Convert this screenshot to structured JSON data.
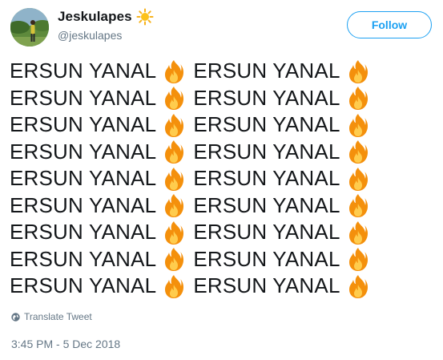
{
  "user": {
    "display_name": "Jeskulapes",
    "handle": "@jeskulapes",
    "name_emoji_icon": "sun-icon",
    "avatar_icon": "avatar-photo"
  },
  "follow_button": {
    "label": "Follow",
    "color": "#1da1f2"
  },
  "tweet": {
    "lines": [
      [
        "ERSUN YANAL",
        "ERSUN YANAL"
      ],
      [
        "ERSUN YANAL",
        "ERSUN YANAL"
      ],
      [
        "ERSUN YANAL",
        "ERSUN YANAL"
      ],
      [
        "ERSUN YANAL",
        "ERSUN YANAL"
      ],
      [
        "ERSUN YANAL",
        "ERSUN YANAL"
      ],
      [
        "ERSUN YANAL",
        "ERSUN YANAL"
      ],
      [
        "ERSUN YANAL",
        "ERSUN YANAL"
      ],
      [
        "ERSUN YANAL",
        "ERSUN YANAL"
      ],
      [
        "ERSUN YANAL",
        "ERSUN YANAL"
      ]
    ],
    "emoji_icon": "fire-icon"
  },
  "translate": {
    "label": "Translate Tweet",
    "icon": "globe-icon"
  },
  "timestamp": "3:45 PM - 5 Dec 2018",
  "colors": {
    "text": "#14171a",
    "secondary": "#657786",
    "accent": "#1da1f2"
  }
}
